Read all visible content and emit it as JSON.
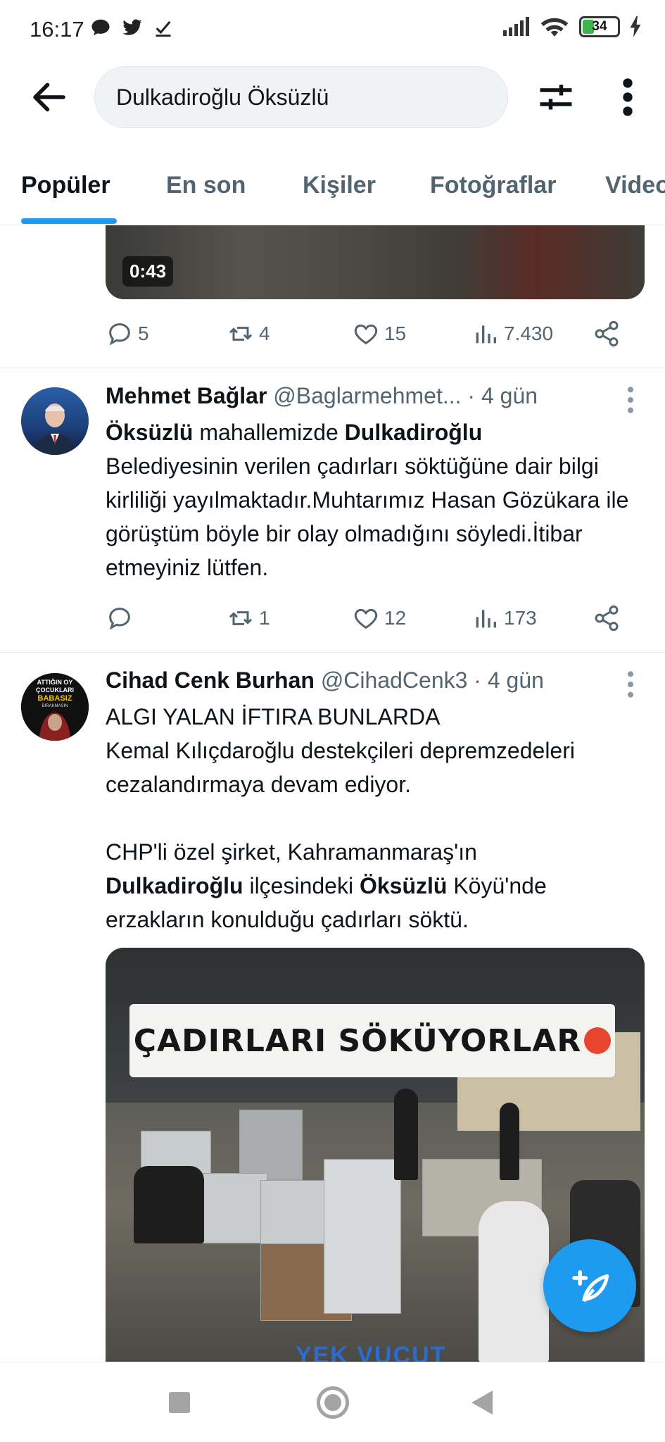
{
  "status": {
    "time": "16:17",
    "battery": "34"
  },
  "search": {
    "query": "Dulkadiroğlu Öksüzlü"
  },
  "tabs": [
    {
      "label": "Popüler"
    },
    {
      "label": "En son"
    },
    {
      "label": "Kişiler"
    },
    {
      "label": "Fotoğraflar"
    },
    {
      "label": "Video"
    }
  ],
  "top_media": {
    "duration": "0:43"
  },
  "top_actions": {
    "replies": "5",
    "retweets": "4",
    "likes": "15",
    "views": "7.430"
  },
  "tweets": [
    {
      "name": "Mehmet Bağlar",
      "handle": "@Baglarmehmet...",
      "time": "· 4 gün",
      "body": {
        "b1": "Öksüzlü",
        "t1": " mahallemizde ",
        "b2": "Dulkadiroğlu",
        "t2": "Belediyesinin verilen çadırları söktüğüne dair bilgi kirliliği yayılmaktadır.Muhtarımız Hasan Gözükara ile görüştüm böyle bir olay olmadığını söyledi.İtibar etmeyiniz lütfen."
      },
      "actions": {
        "replies": "",
        "retweets": "1",
        "likes": "12",
        "views": "173"
      }
    },
    {
      "name": "Cihad Cenk Burhan",
      "handle": "@CihadCenk3",
      "time": "· 4 gün",
      "avatar_text": [
        "ATTIĞIN OY",
        "ÇOCUKLARI",
        "BABASIZ",
        "BIRAKMASIN"
      ],
      "body": {
        "line1": "ALGI YALAN İFTIRA BUNLARDA",
        "line2": "Kemal Kılıçdaroğlu destekçileri depremzedeleri cezalandırmaya devam ediyor.",
        "line3": "CHP'li özel şirket, Kahramanmaraş'ın",
        "b1": "Dulkadiroğlu",
        "t1": " ilçesindeki ",
        "b2": "Öksüzlü",
        "t2": " Köyü'nde erzakların konulduğu çadırları söktü."
      },
      "media_caption": "ÇADIRLARI SÖKÜYORLAR",
      "media_watermark": "YEK VUCUT"
    }
  ],
  "colors": {
    "accent": "#1d9bf0",
    "secondary_text": "#536471",
    "primary_text": "#0f1419"
  }
}
